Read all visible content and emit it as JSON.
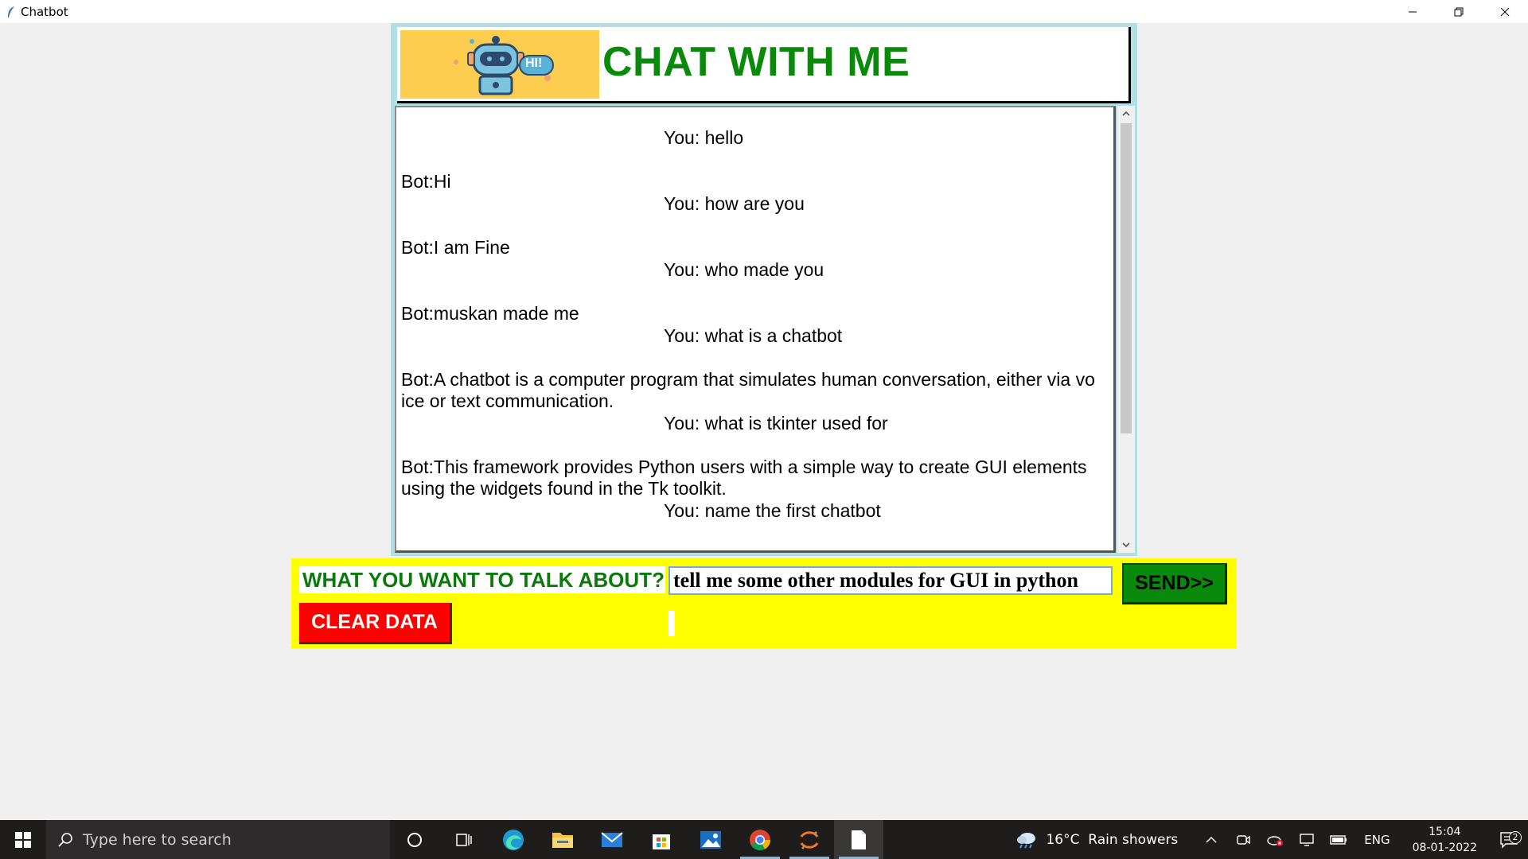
{
  "window": {
    "title": "Chatbot"
  },
  "header": {
    "logo_text": "HI!",
    "title": "CHAT WITH ME"
  },
  "chat": {
    "messages": [
      {
        "sender": "you",
        "text": "You: hello"
      },
      {
        "sender": "bot",
        "text": "Bot:Hi"
      },
      {
        "sender": "you",
        "text": "You: how are you"
      },
      {
        "sender": "bot",
        "text": "Bot:I am Fine"
      },
      {
        "sender": "you",
        "text": "You: who made you"
      },
      {
        "sender": "bot",
        "text": "Bot:muskan made me"
      },
      {
        "sender": "you",
        "text": "You: what is a chatbot"
      },
      {
        "sender": "bot",
        "text": "Bot:A chatbot is a computer program that simulates human conversation, either via vo"
      },
      {
        "sender": "bot",
        "text": "ice or text communication."
      },
      {
        "sender": "you",
        "text": "You: what is tkinter used for"
      },
      {
        "sender": "bot",
        "text": "Bot:This framework provides Python users with a simple way to create GUI elements"
      },
      {
        "sender": "bot",
        "text": "using the widgets found in the Tk toolkit."
      },
      {
        "sender": "you",
        "text": "You: name the first chatbot"
      }
    ]
  },
  "input_panel": {
    "prompt_label": "WHAT YOU WANT TO TALK ABOUT?",
    "input_value": "tell me some other modules for GUI in python",
    "send_label": "SEND>>",
    "clear_label": "CLEAR DATA"
  },
  "taskbar": {
    "search_placeholder": "Type here to search",
    "weather": "16°C  Rain showers",
    "language": "ENG",
    "time": "15:04",
    "date": "08-01-2022",
    "notification_count": "2"
  },
  "colors": {
    "header_title": "#0a8a0a",
    "input_panel_bg": "#ffff00",
    "send_button": "#0a8a0a",
    "clear_button": "#ff0000",
    "logo_bg": "#fdcd4f"
  }
}
